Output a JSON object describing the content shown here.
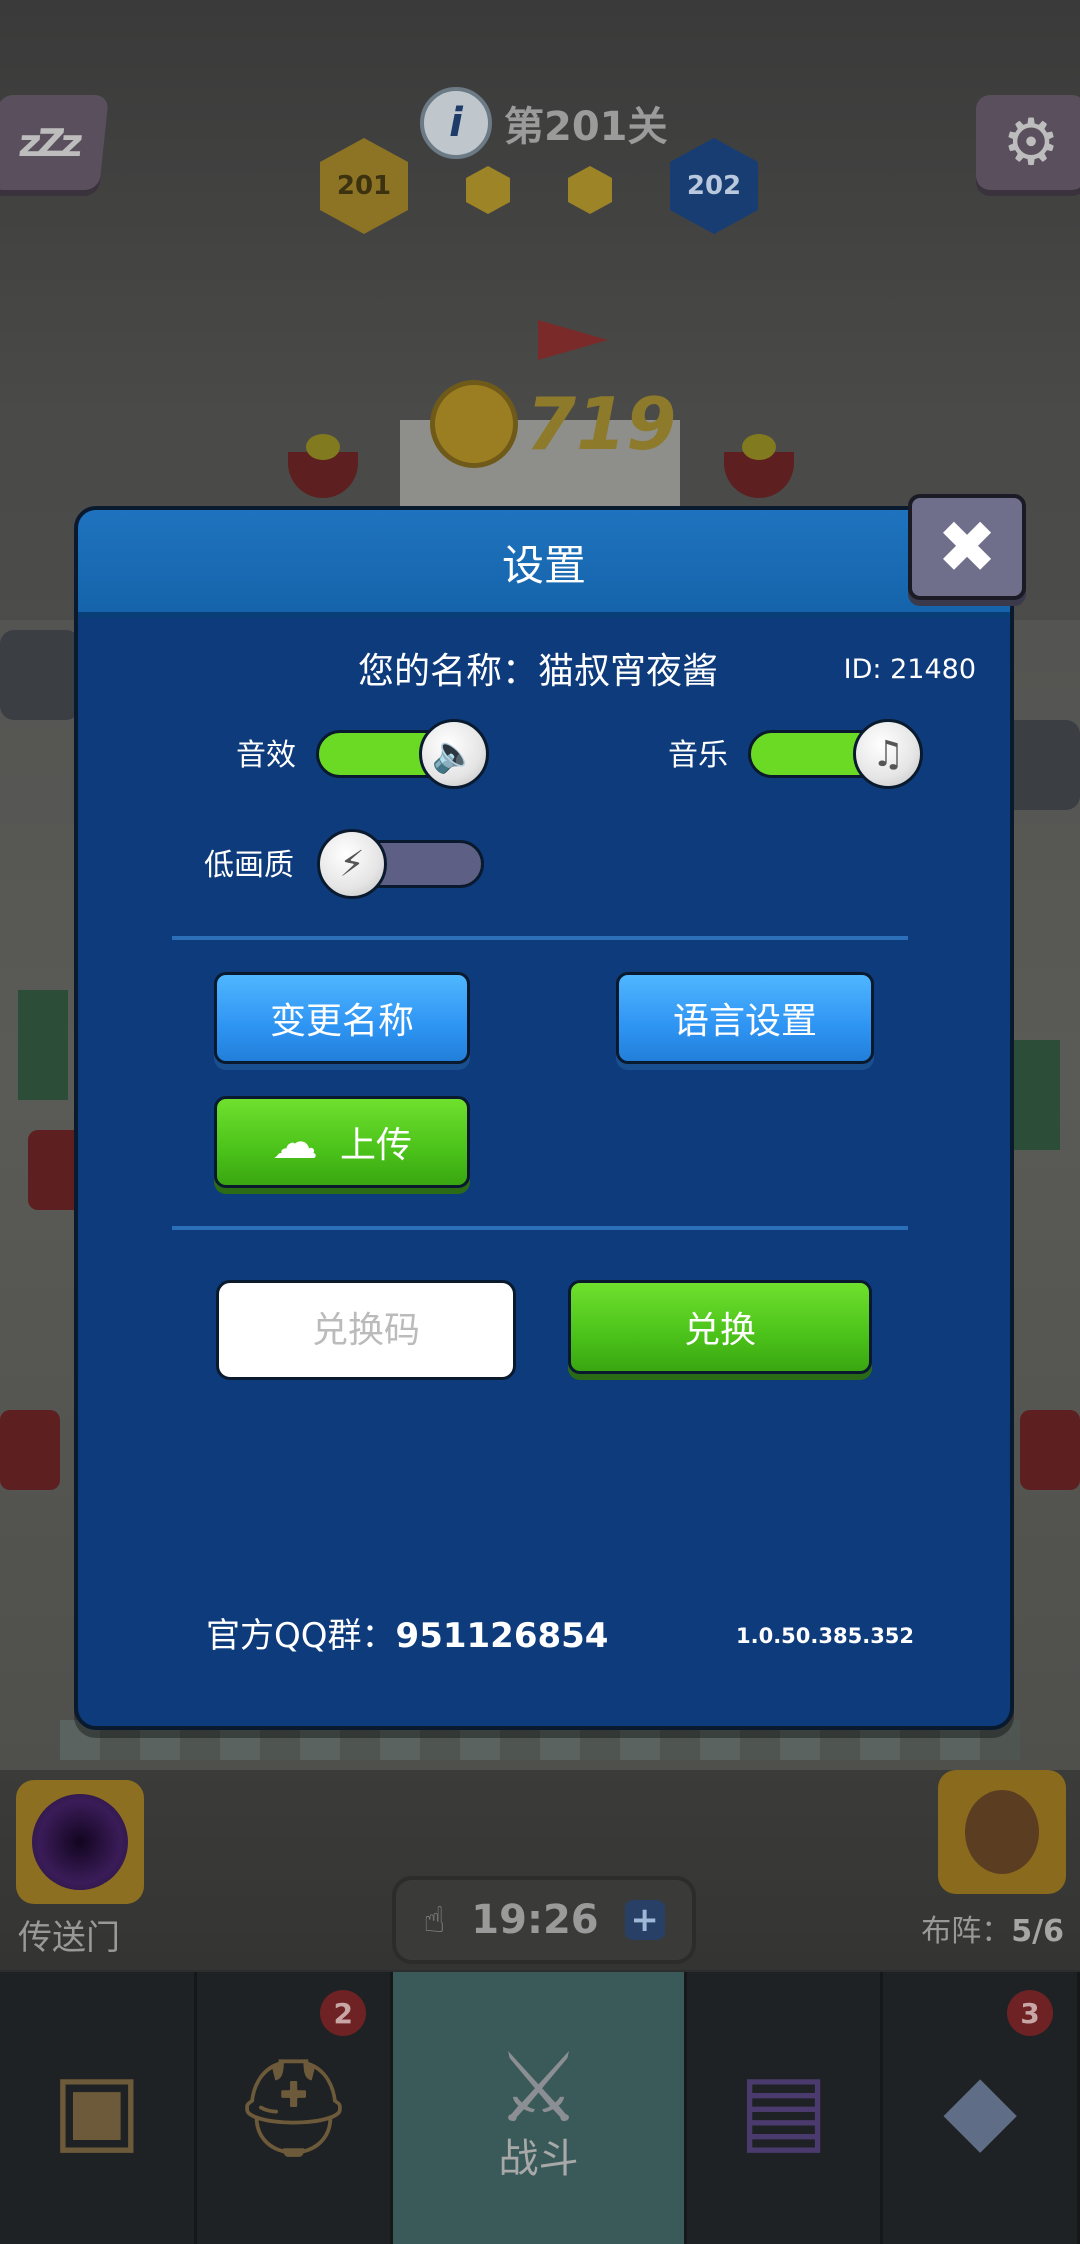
{
  "hud": {
    "sleep_icon_text": "zZz",
    "level_label": "第201关",
    "current_level": "201",
    "next_level": "202",
    "coins": "719",
    "portal_label": "传送门",
    "timer": "19:26",
    "team_label": "布阵：",
    "team_count": "5/6"
  },
  "nav": {
    "tabs": [
      {
        "icon": "chest-icon",
        "badge": ""
      },
      {
        "icon": "helmet-icon",
        "badge": "2"
      },
      {
        "icon": "crossed-swords-icon",
        "label": "战斗"
      },
      {
        "icon": "book-icon",
        "badge": ""
      },
      {
        "icon": "amulet-icon",
        "badge": "3"
      }
    ]
  },
  "settings": {
    "title": "设置",
    "name_line": "您的名称：猫叔宵夜酱",
    "id_line": "ID:  21480",
    "sound_label": "音效",
    "music_label": "音乐",
    "low_quality_label": "低画质",
    "sound_on": true,
    "music_on": true,
    "low_quality_on": false,
    "rename_button": "变更名称",
    "language_button": "语言设置",
    "upload_button": "上传",
    "redeem_placeholder": "兑换码",
    "redeem_button": "兑换",
    "qq_prefix": "官方QQ群：",
    "qq_number": "951126854",
    "version": "1.0.50.385.352"
  },
  "colors": {
    "dialog_bg": "#0d3b7b",
    "header_bg": "#1f73be",
    "toggle_on": "#6ada24",
    "toggle_off": "#5e5f84",
    "button_blue": "#2e94f3",
    "button_green": "#4bc21a"
  }
}
